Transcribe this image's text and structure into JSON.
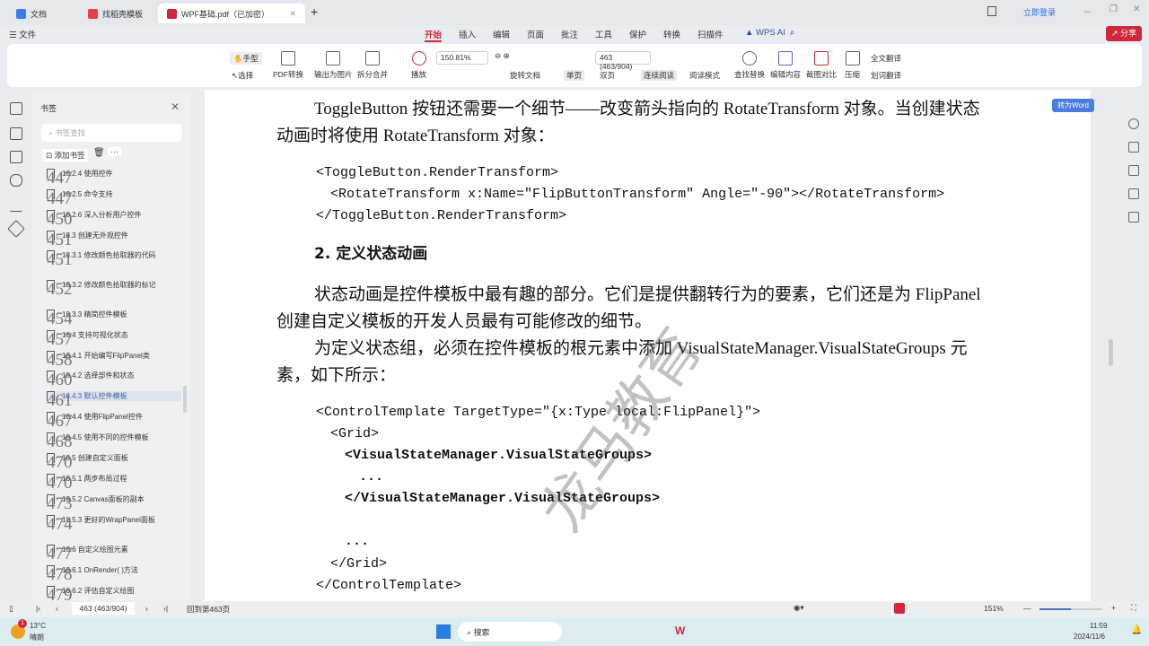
{
  "tabs": [
    {
      "label": "文档",
      "color": "#3b7ce8"
    },
    {
      "label": "找稻壳模板",
      "color": "#e5404a"
    },
    {
      "label": "WPF基础.pdf（已加密）",
      "color": "#d0283a"
    }
  ],
  "login": "立即登录",
  "menu": {
    "file": "文件",
    "items": [
      "开始",
      "插入",
      "编辑",
      "页面",
      "批注",
      "工具",
      "保护",
      "转换",
      "扫描件"
    ],
    "ai": "WPS AI",
    "share": "分享"
  },
  "ribbon": {
    "hand": "手型",
    "select": "选择",
    "pdf_convert": "PDF转换",
    "export_image": "输出为图片",
    "split_merge": "拆分合并",
    "play": "播放",
    "zoom": "150.81%",
    "page": "463 (463/904)",
    "rotate": "旋转文档",
    "single": "单页",
    "double": "双页",
    "continuous": "连续阅读",
    "read_mode": "阅读模式",
    "find_replace": "查找替换",
    "edit_content": "编辑内容",
    "compare": "截图对比",
    "compress": "压缩",
    "full_translate": "全文翻译",
    "word_translate": "划词翻译"
  },
  "sidebar": {
    "title": "书签",
    "search_placeholder": "书签查找",
    "add": "添加书签",
    "more": "···",
    "items": [
      {
        "t": "18.2.4 使用控件",
        "p": "447"
      },
      {
        "t": "18.2.5 命令支持",
        "p": "447"
      },
      {
        "t": "18.2.6 深入分析用户控件",
        "p": "450"
      },
      {
        "t": "18.3 创建无外观控件",
        "p": "451"
      },
      {
        "t": "18.3.1 修改颜色拾取器的代码",
        "p": "451"
      },
      {
        "t": "18.3.2 修改颜色拾取器的标记",
        "p": "452"
      },
      {
        "t": "18.3.3 精简控件模板",
        "p": "454"
      },
      {
        "t": "18.4 支持可视化状态",
        "p": "457"
      },
      {
        "t": "18.4.1 开始编写FlipPanel类",
        "p": "458"
      },
      {
        "t": "18.4.2 选择部件和状态",
        "p": "460"
      },
      {
        "t": "18.4.3 默认控件模板",
        "p": "461"
      },
      {
        "t": "18.4.4 使用FlipPanel控件",
        "p": "467"
      },
      {
        "t": "18.4.5 使用不同的控件模板",
        "p": "468"
      },
      {
        "t": "18.5 创建自定义面板",
        "p": "470"
      },
      {
        "t": "18.5.1 两步布局过程",
        "p": "470"
      },
      {
        "t": "18.5.2 Canvas面板的副本",
        "p": "473"
      },
      {
        "t": "18.5.3 更好的WrapPanel面板",
        "p": "474"
      },
      {
        "t": "18.6 自定义绘图元素",
        "p": "477"
      },
      {
        "t": "18.6.1 OnRender( )方法",
        "p": "478"
      },
      {
        "t": "18.6.2 评估自定义绘图",
        "p": "479"
      }
    ]
  },
  "doc": {
    "p1a": "ToggleButton 按钮还需要一个细节——改变箭头指向的 RotateTransform 对象。当创建状态",
    "p1b": "动画时将使用 RotateTransform 对象：",
    "c1": "<ToggleButton.RenderTransform>",
    "c2": "<RotateTransform x:Name=\"FlipButtonTransform\" Angle=\"-90\"></RotateTransform>",
    "c3": "</ToggleButton.RenderTransform>",
    "h2": "2. 定义状态动画",
    "p2a": "状态动画是控件模板中最有趣的部分。它们是提供翻转行为的要素，它们还是为 FlipPanel",
    "p2b": "创建自定义模板的开发人员最有可能修改的细节。",
    "p3a": "为定义状态组，必须在控件模板的根元素中添加 VisualStateManager.VisualStateGroups 元",
    "p3b": "素，如下所示：",
    "d1": "<ControlTemplate TargetType=\"{x:Type local:FlipPanel}\">",
    "d2": "<Grid>",
    "d3": "<VisualStateManager.VisualStateGroups>",
    "d4": "...",
    "d5": "</VisualStateManager.VisualStateGroups>",
    "d6": "...",
    "d7": "</Grid>",
    "d8": "</ControlTemplate>",
    "watermark": "龙马教育",
    "to_word": "转为Word"
  },
  "status": {
    "page": "463 (463/904)",
    "back": "回到第463页",
    "zoom": "151%",
    "zoom_fraction": 0.5
  },
  "taskbar": {
    "temp": "13°C",
    "weather": "晴朗",
    "badge": "1",
    "search": "搜索",
    "time": "11:59",
    "date": "2024/11/6"
  }
}
